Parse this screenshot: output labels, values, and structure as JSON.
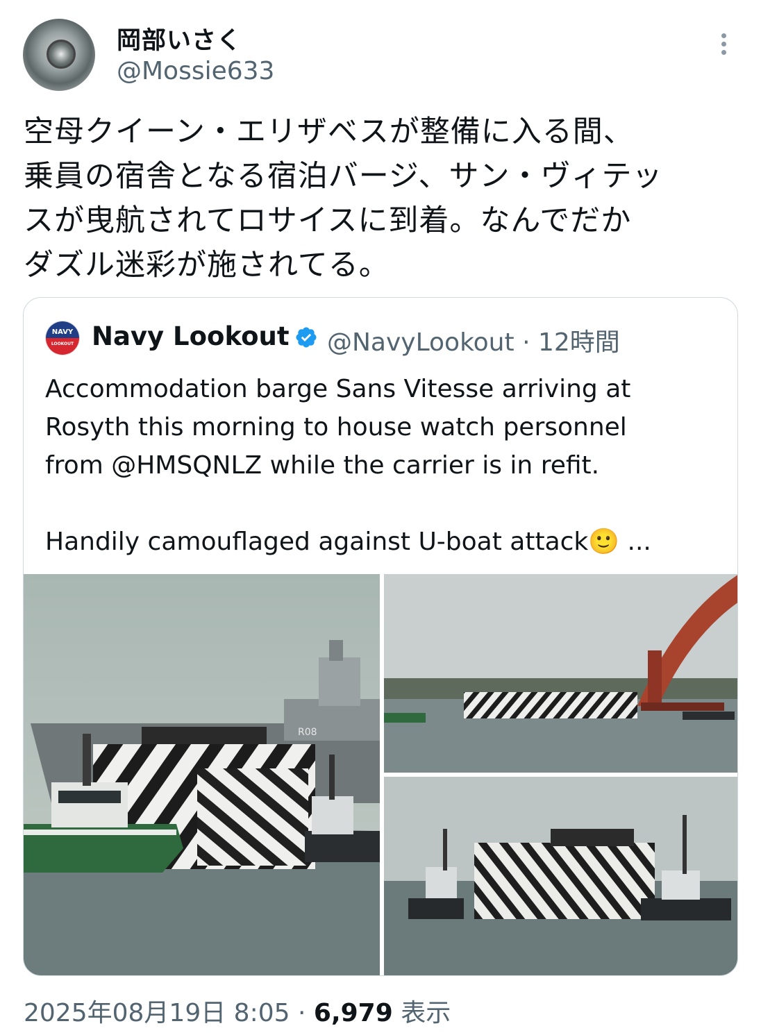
{
  "author": {
    "display_name": "岡部いさく",
    "handle": "@Mossie633"
  },
  "tweet_lines": [
    "空母クイーン・エリザベスが整備に入る間、",
    "乗員の宿舎となる宿泊バージ、サン・ヴィテッ",
    "スが曳航されてロサイスに到着。なんでだか",
    "ダズル迷彩が施されてる。"
  ],
  "quoted": {
    "avatar_text_top": "NAVY",
    "avatar_text_bottom": "LOOKOUT",
    "display_name": "Navy Lookout",
    "handle": "@NavyLookout",
    "separator": "·",
    "time": "12時間",
    "text_lines": [
      "Accommodation barge Sans Vitesse arriving at",
      "Rosyth this morning to house watch personnel",
      "from @HMSQNLZ while the carrier is in refit.",
      "",
      "Handily camouflaged against U-boat attack🙂 ..."
    ],
    "hull_marking": "R08"
  },
  "footer": {
    "datetime": "2025年08月19日 8:05",
    "separator": "·",
    "views": "6,979",
    "views_label": "表示"
  },
  "colors": {
    "text": "#0f1419",
    "secondary": "#536471",
    "border": "#cfd9de",
    "verified": "#1d9bf0",
    "tug_green": "#2f6a3e",
    "bridge_red": "#a8432e"
  },
  "icons": [
    "more-icon",
    "verified-icon",
    "navy-lookout-logo"
  ]
}
